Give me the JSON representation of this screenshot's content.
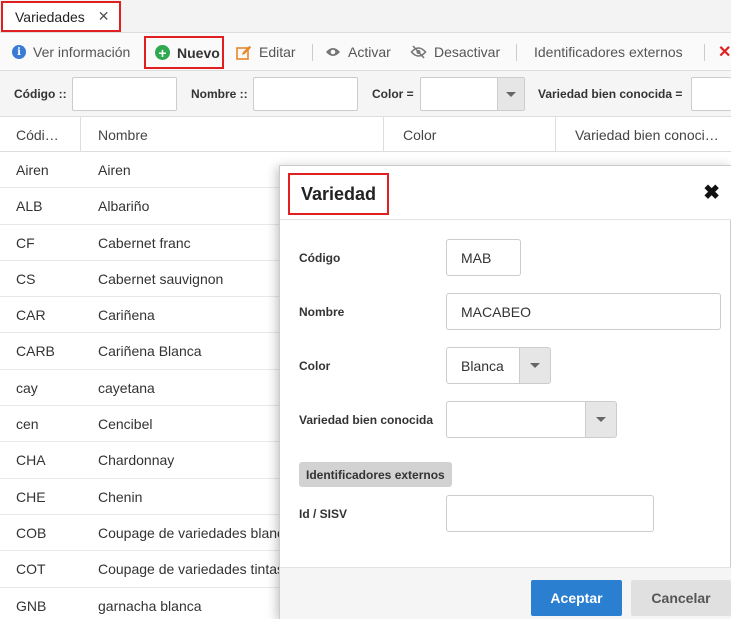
{
  "tab": {
    "label": "Variedades",
    "close": "✕"
  },
  "toolbar": {
    "info": "Ver información",
    "new": "Nuevo",
    "edit": "Editar",
    "activate": "Activar",
    "deactivate": "Desactivar",
    "external": "Identificadores externos",
    "delete": "✕"
  },
  "filters": {
    "codigo": "Código ::",
    "nombre": "Nombre ::",
    "color": "Color =",
    "conocida": "Variedad bien conocida ="
  },
  "table": {
    "headers": [
      "Códi…",
      "Nombre",
      "Color",
      "Variedad bien conoci…"
    ],
    "rows": [
      [
        "Airen",
        "Airen"
      ],
      [
        "ALB",
        "Albariño"
      ],
      [
        "CF",
        "Cabernet franc"
      ],
      [
        "CS",
        "Cabernet sauvignon"
      ],
      [
        "CAR",
        "Cariñena"
      ],
      [
        "CARB",
        "Cariñena Blanca"
      ],
      [
        "cay",
        "cayetana"
      ],
      [
        "cen",
        "Cencibel"
      ],
      [
        "CHA",
        "Chardonnay"
      ],
      [
        "CHE",
        "Chenin"
      ],
      [
        "COB",
        "Coupage de variedades blancas"
      ],
      [
        "COT",
        "Coupage de variedades tintas"
      ],
      [
        "GNB",
        "garnacha blanca"
      ]
    ]
  },
  "modal": {
    "title": "Variedad",
    "close": "✖",
    "fields": {
      "codigo_label": "Código",
      "codigo_value": "MAB",
      "nombre_label": "Nombre",
      "nombre_value": "MACABEO",
      "color_label": "Color",
      "color_value": "Blanca",
      "conocida_label": "Variedad bien conocida",
      "conocida_value": "",
      "section": "Identificadores externos",
      "sisv_label": "Id / SISV",
      "sisv_value": ""
    },
    "accept": "Aceptar",
    "cancel": "Cancelar"
  },
  "colors": {
    "accent": "#2b7fd1",
    "highlight": "#e02020",
    "new_icon": "#2fa84f",
    "info_icon": "#3a7bd5",
    "edit_icon": "#e8872b",
    "delete_icon": "#e02020"
  }
}
